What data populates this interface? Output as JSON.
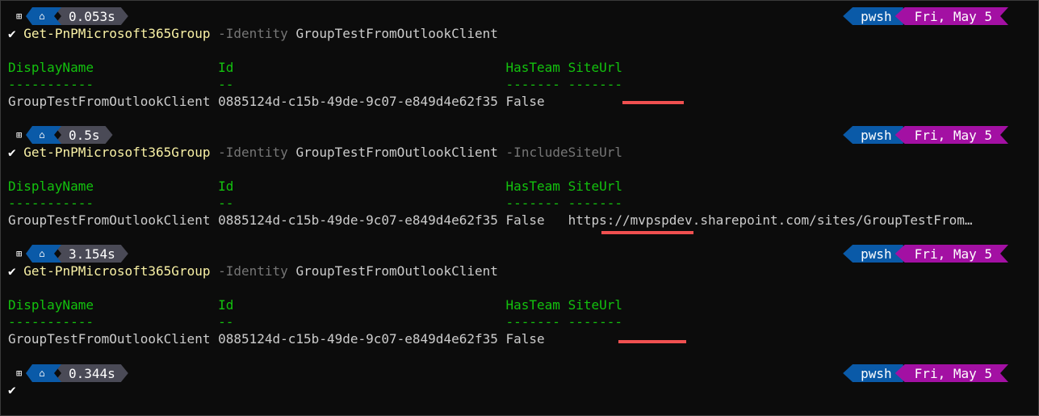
{
  "prompts": [
    {
      "os_icon": "⊞",
      "home_icon": "⌂",
      "elapsed": "0.053s",
      "shell": "pwsh",
      "date": "Fri, May 5"
    },
    {
      "os_icon": "⊞",
      "home_icon": "⌂",
      "elapsed": "0.5s",
      "shell": "pwsh",
      "date": "Fri, May 5"
    },
    {
      "os_icon": "⊞",
      "home_icon": "⌂",
      "elapsed": "3.154s",
      "shell": "pwsh",
      "date": "Fri, May 5"
    },
    {
      "os_icon": "⊞",
      "home_icon": "⌂",
      "elapsed": "0.344s",
      "shell": "pwsh",
      "date": "Fri, May 5"
    }
  ],
  "commands": [
    {
      "check": "✔",
      "cmdlet": "Get-PnPMicrosoft365Group",
      "param1": "-Identity",
      "value1": "GroupTestFromOutlookClient",
      "param2": ""
    },
    {
      "check": "✔",
      "cmdlet": "Get-PnPMicrosoft365Group",
      "param1": "-Identity",
      "value1": "GroupTestFromOutlookClient",
      "param2": "-IncludeSiteUrl"
    },
    {
      "check": "✔",
      "cmdlet": "Get-PnPMicrosoft365Group",
      "param1": "-Identity",
      "value1": "GroupTestFromOutlookClient",
      "param2": ""
    }
  ],
  "last_check": "✔",
  "table": {
    "headers": "DisplayName                Id                                   HasTeam SiteUrl",
    "underlines": "-----------                --                                   ------- -------",
    "rows": [
      "GroupTestFromOutlookClient 0885124d-c15b-49de-9c07-e849d4e62f35 False",
      "GroupTestFromOutlookClient 0885124d-c15b-49de-9c07-e849d4e62f35 False   https://mvpspdev.sharepoint.com/sites/GroupTestFrom…",
      "GroupTestFromOutlookClient 0885124d-c15b-49de-9c07-e849d4e62f35 False"
    ]
  },
  "colors": {
    "background": "#0c0c0c",
    "command": "#f9f1a5",
    "header": "#13c20e",
    "parameter": "#767676",
    "shell_segment": "#0a5aa8",
    "date_segment": "#a310a3",
    "time_segment": "#4a4a56",
    "highlight": "#f05050"
  }
}
